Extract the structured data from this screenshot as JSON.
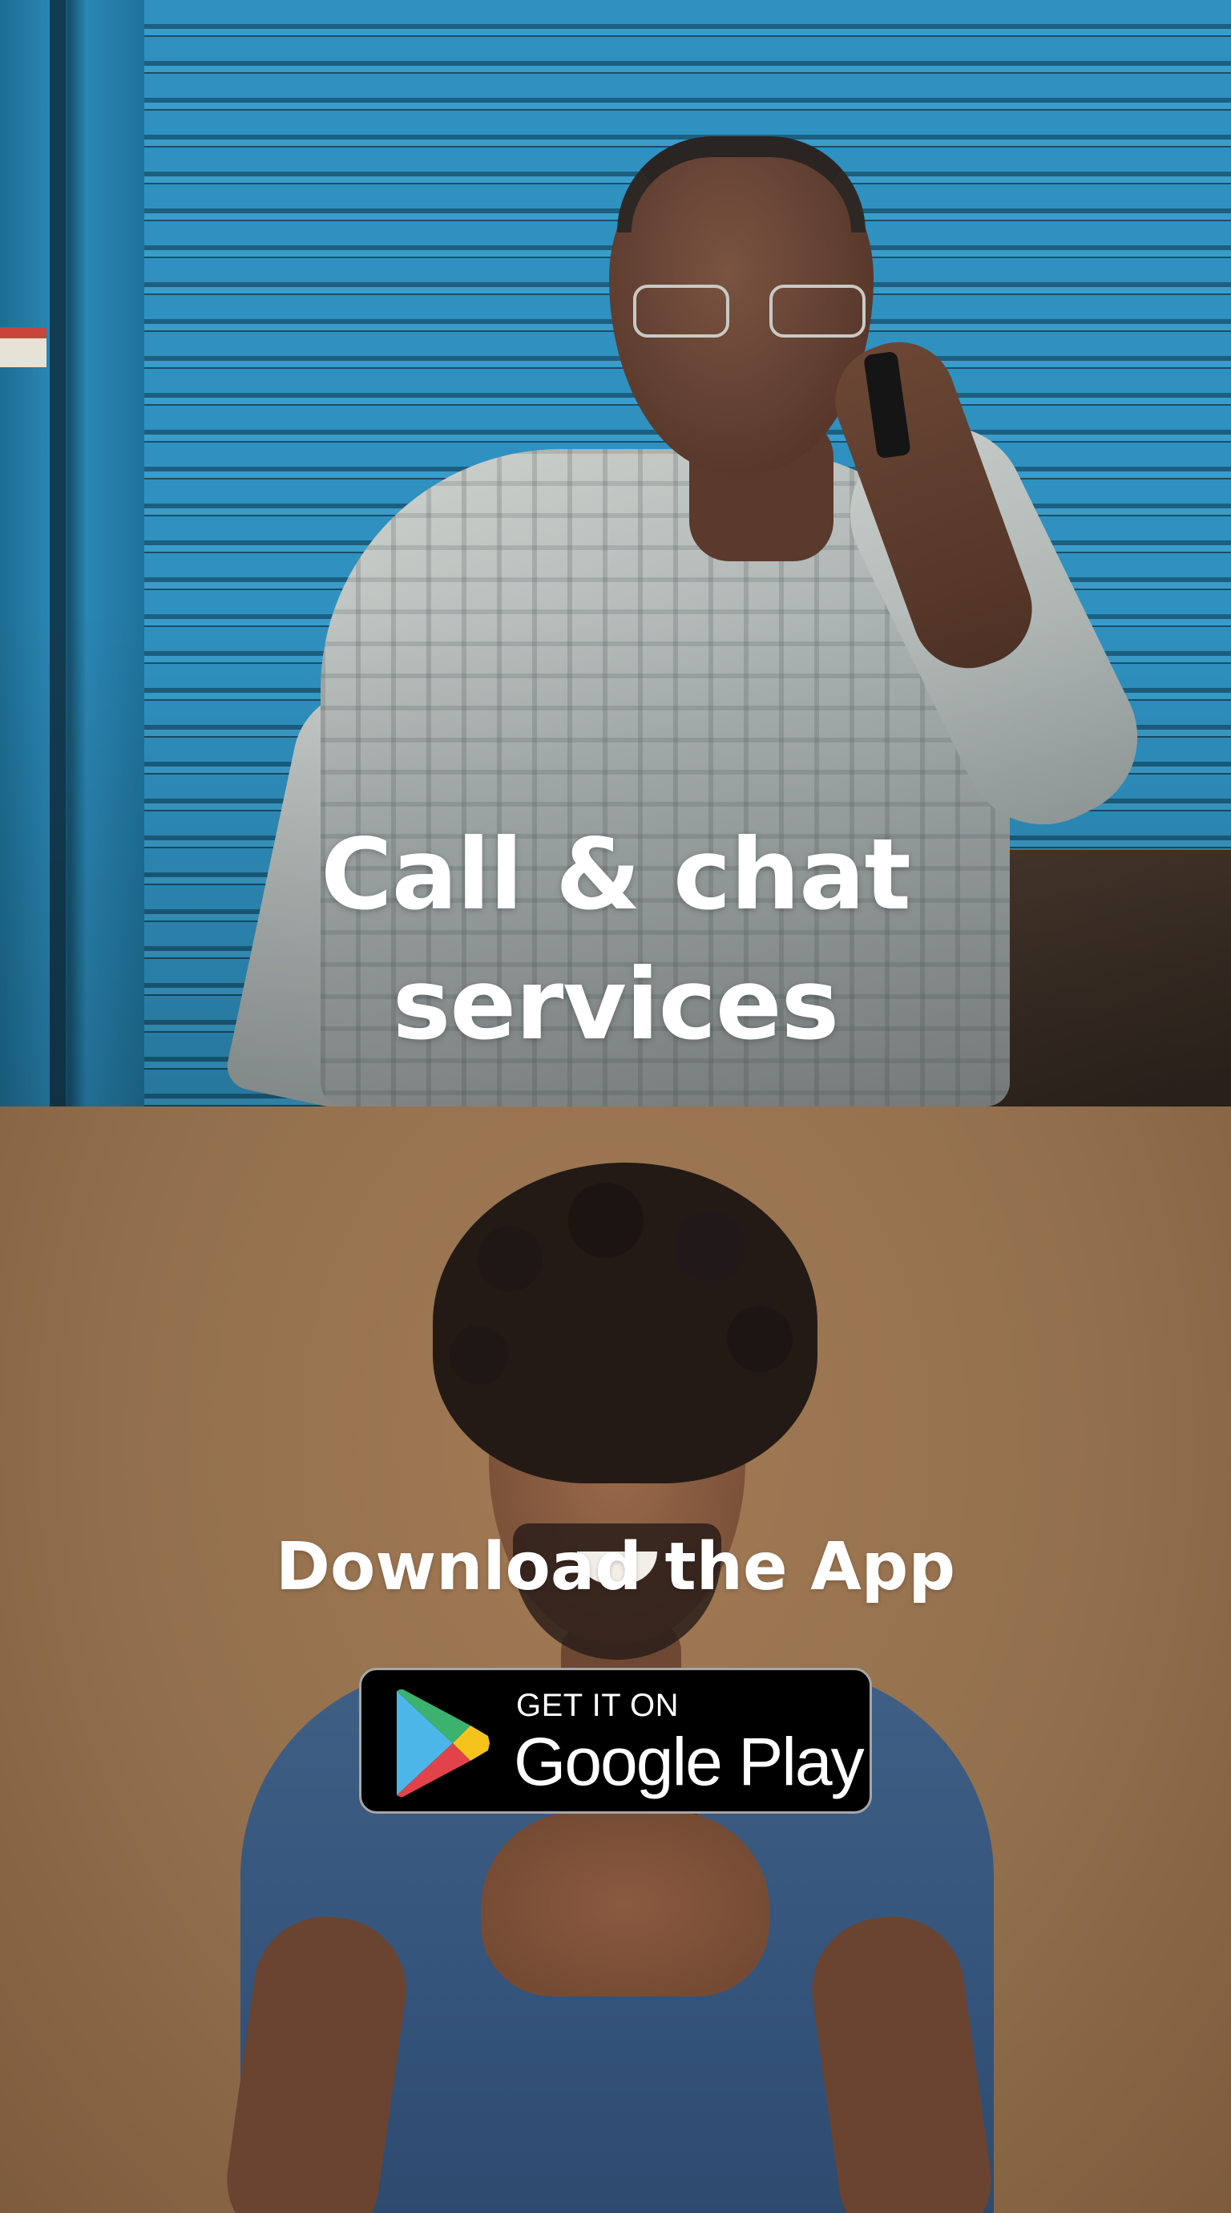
{
  "hero": {
    "heading_line1": "Call & chat",
    "heading_line2": "services"
  },
  "download": {
    "heading": "Download the App",
    "badge": {
      "top_text": "GET IT ON",
      "main_text": "Google Play",
      "icon": "google-play-icon"
    }
  },
  "colors": {
    "shutter_blue": "#2f91c0",
    "tan_background": "#93704d",
    "badge_background": "#000000",
    "text": "#ffffff"
  }
}
